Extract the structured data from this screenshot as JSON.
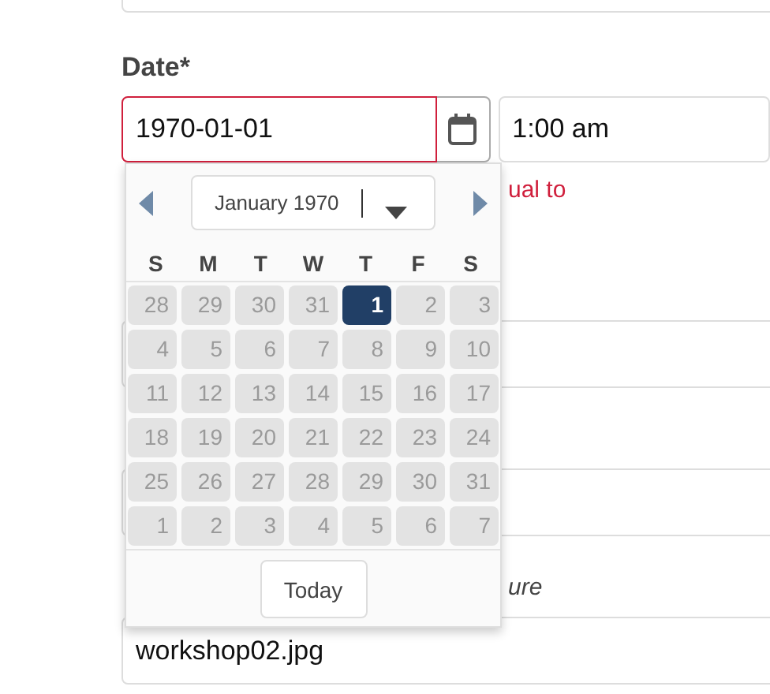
{
  "date_field": {
    "label": "Date*",
    "value": "1970-01-01",
    "invalid": true
  },
  "time_field": {
    "value": "1:00 am"
  },
  "error_text": "ual to",
  "hint_text": "ure",
  "file_field": {
    "value": "workshop02.jpg"
  },
  "datepicker": {
    "month_label": "January 1970",
    "weekdays": [
      "S",
      "M",
      "T",
      "W",
      "T",
      "F",
      "S"
    ],
    "weeks": [
      [
        {
          "day": "28",
          "selected": false
        },
        {
          "day": "29",
          "selected": false
        },
        {
          "day": "30",
          "selected": false
        },
        {
          "day": "31",
          "selected": false
        },
        {
          "day": "1",
          "selected": true
        },
        {
          "day": "2",
          "selected": false
        },
        {
          "day": "3",
          "selected": false
        }
      ],
      [
        {
          "day": "4",
          "selected": false
        },
        {
          "day": "5",
          "selected": false
        },
        {
          "day": "6",
          "selected": false
        },
        {
          "day": "7",
          "selected": false
        },
        {
          "day": "8",
          "selected": false
        },
        {
          "day": "9",
          "selected": false
        },
        {
          "day": "10",
          "selected": false
        }
      ],
      [
        {
          "day": "11",
          "selected": false
        },
        {
          "day": "12",
          "selected": false
        },
        {
          "day": "13",
          "selected": false
        },
        {
          "day": "14",
          "selected": false
        },
        {
          "day": "15",
          "selected": false
        },
        {
          "day": "16",
          "selected": false
        },
        {
          "day": "17",
          "selected": false
        }
      ],
      [
        {
          "day": "18",
          "selected": false
        },
        {
          "day": "19",
          "selected": false
        },
        {
          "day": "20",
          "selected": false
        },
        {
          "day": "21",
          "selected": false
        },
        {
          "day": "22",
          "selected": false
        },
        {
          "day": "23",
          "selected": false
        },
        {
          "day": "24",
          "selected": false
        }
      ],
      [
        {
          "day": "25",
          "selected": false
        },
        {
          "day": "26",
          "selected": false
        },
        {
          "day": "27",
          "selected": false
        },
        {
          "day": "28",
          "selected": false
        },
        {
          "day": "29",
          "selected": false
        },
        {
          "day": "30",
          "selected": false
        },
        {
          "day": "31",
          "selected": false
        }
      ],
      [
        {
          "day": "1",
          "selected": false
        },
        {
          "day": "2",
          "selected": false
        },
        {
          "day": "3",
          "selected": false
        },
        {
          "day": "4",
          "selected": false
        },
        {
          "day": "5",
          "selected": false
        },
        {
          "day": "6",
          "selected": false
        },
        {
          "day": "7",
          "selected": false
        }
      ]
    ],
    "today_button": "Today"
  }
}
